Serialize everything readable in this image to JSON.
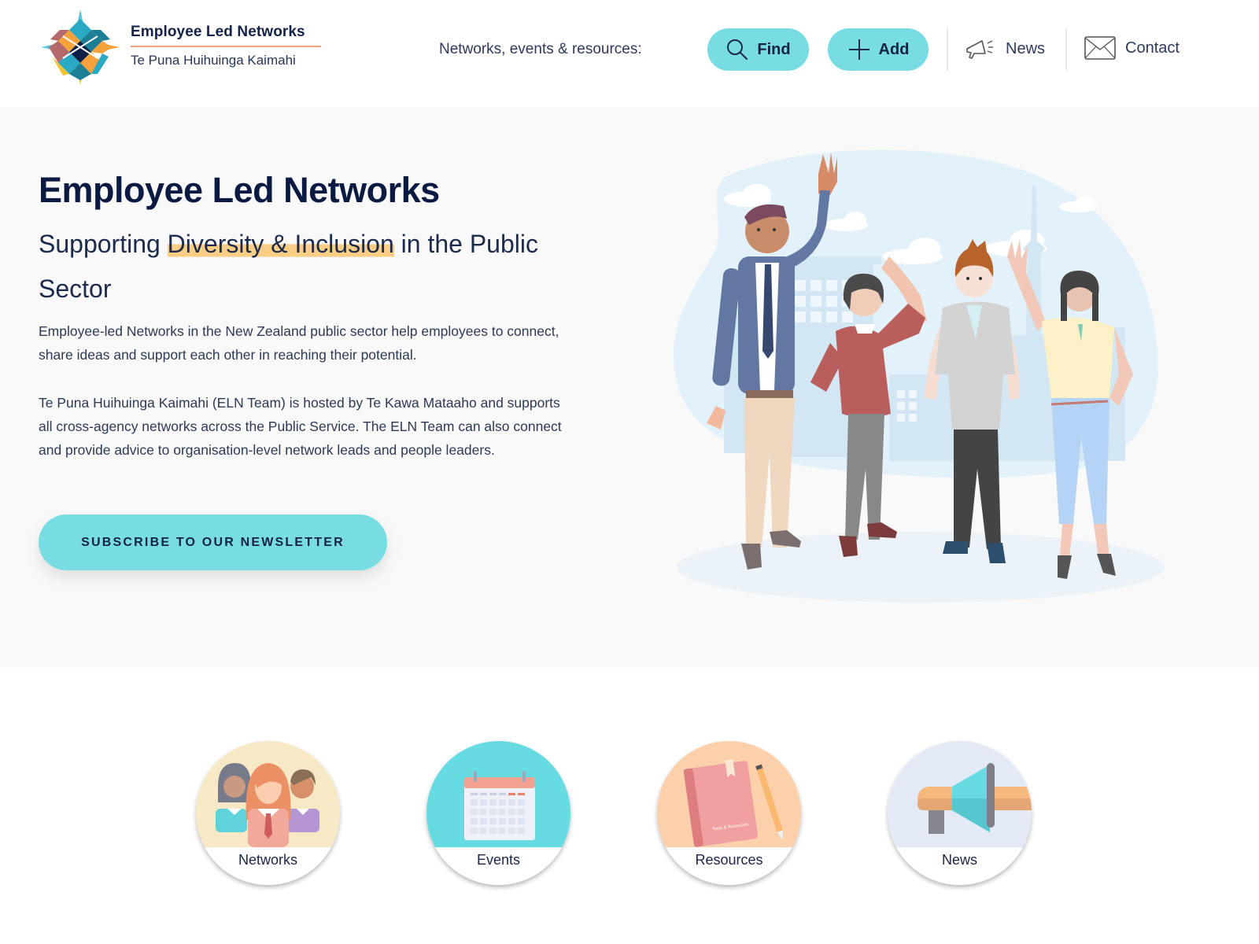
{
  "header": {
    "logo_icon": "woven-diamond-logo",
    "brand_title": "Employee Led Networks",
    "brand_subtitle": "Te Puna Huihuinga Kaimahi",
    "nav_label": "Networks, events & resources:",
    "find_button": {
      "label": "Find",
      "icon": "search-icon"
    },
    "add_button": {
      "label": "Add",
      "icon": "plus-icon"
    },
    "news_link": {
      "label": "News",
      "icon": "megaphone-icon"
    },
    "contact_link": {
      "label": "Contact",
      "icon": "envelope-icon"
    }
  },
  "hero": {
    "title": "Employee Led Networks",
    "subtitle_before": "Supporting ",
    "subtitle_highlight": "Diversity & Inclusion",
    "subtitle_after": " in the Public Sector",
    "paragraph_1": "Employee-led Networks in the New Zealand public sector help employees to connect, share ideas and support each other in reaching their potential.",
    "paragraph_2": "Te Puna Huihuinga Kaimahi (ELN Team) is hosted by Te Kawa Mataaho and supports all cross-agency networks across the Public Service. The ELN Team can also connect and provide advice to organisation-level network leads and people leaders.",
    "subscribe_button": "SUBSCRIBE TO OUR NEWSLETTER",
    "illustration": "four-people-waving-city-skyline"
  },
  "tiles": [
    {
      "label": "Networks",
      "icon": "people-group-icon"
    },
    {
      "label": "Events",
      "icon": "calendar-icon"
    },
    {
      "label": "Resources",
      "icon": "book-pencil-icon",
      "book_text": "Tools & Resources"
    },
    {
      "label": "News",
      "icon": "megaphone-icon"
    }
  ],
  "colors": {
    "accent_teal": "#78dde2",
    "navy_text": "#0b1a42",
    "highlight": "#fbcd85",
    "brand_rule": "#f4a07a",
    "hero_bg": "#f9f9f9"
  }
}
